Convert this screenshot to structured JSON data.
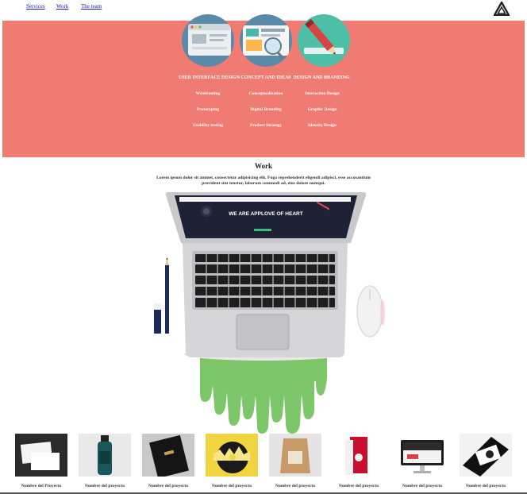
{
  "nav": {
    "links": [
      "Services",
      "Work",
      "The team"
    ]
  },
  "services": {
    "headings": [
      "USER INTERFACE DESIGN",
      "CONCEPT AND IDEAS",
      "DESIGN AND BRANDING"
    ],
    "columns": [
      [
        "Wireframing",
        "Prototyping",
        "Usability testing"
      ],
      [
        "Conceptualization",
        "Digital Branding",
        "Product Strategy"
      ],
      [
        "Interaction Design",
        "Graphic Design",
        "Identity Design"
      ]
    ]
  },
  "work": {
    "title": "Work",
    "description": "Lorem ipsum dolor sit ammet, consectetur adipisicing elit. Fuga reprehenderit eligendi adipisci, esse accusantium provident sint tenetur, laborum commodi ad, eius dolore numqui.",
    "screen_headline": "WE ARE APPLOVE OF HEART"
  },
  "projects": [
    "Nombre del Proyecto",
    "Nombre del proyecto",
    "Nombre del proyecto",
    "Nombre del proyecto",
    "Nombre del proyecto",
    "Nombre del proyecto",
    "Nombre del proyecto",
    "Nombre del proyecto"
  ],
  "colors": {
    "band": "#f07b72",
    "accent_green": "#7dc66a",
    "link": "#1a1aa6"
  }
}
